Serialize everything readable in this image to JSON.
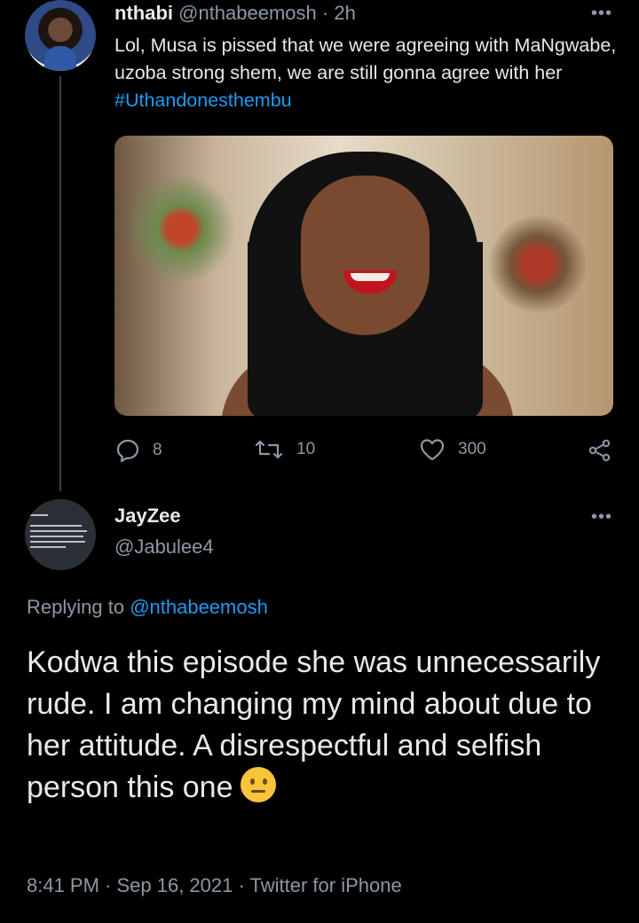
{
  "tweet1": {
    "name": "nthabi",
    "handle": "@nthabeemosh",
    "separator": "·",
    "time": "2h",
    "more": "•••",
    "text_before": "Lol, Musa is pissed that we were agreeing with MaNgwabe, uzoba strong shem, we are still gonna agree with her ",
    "hashtag": "#Uthandonesthembu",
    "actions": {
      "replies": "8",
      "retweets": "10",
      "likes": "300"
    }
  },
  "tweet2": {
    "name": "JayZee",
    "handle": "@Jabulee4",
    "more": "•••",
    "replying_prefix": "Replying to ",
    "replying_mention": "@nthabeemosh",
    "text": "Kodwa this episode she was unnecessarily rude. I am changing my mind about due to her attitude. A disrespectful and selfish person this one",
    "emoji": "neutral-face-emoji",
    "meta": "8:41 PM · Sep 16, 2021 · Twitter for iPhone"
  },
  "colors": {
    "background": "#000000",
    "text": "#e7e9ea",
    "muted": "#8b98a5",
    "link": "#1d9bf0"
  }
}
